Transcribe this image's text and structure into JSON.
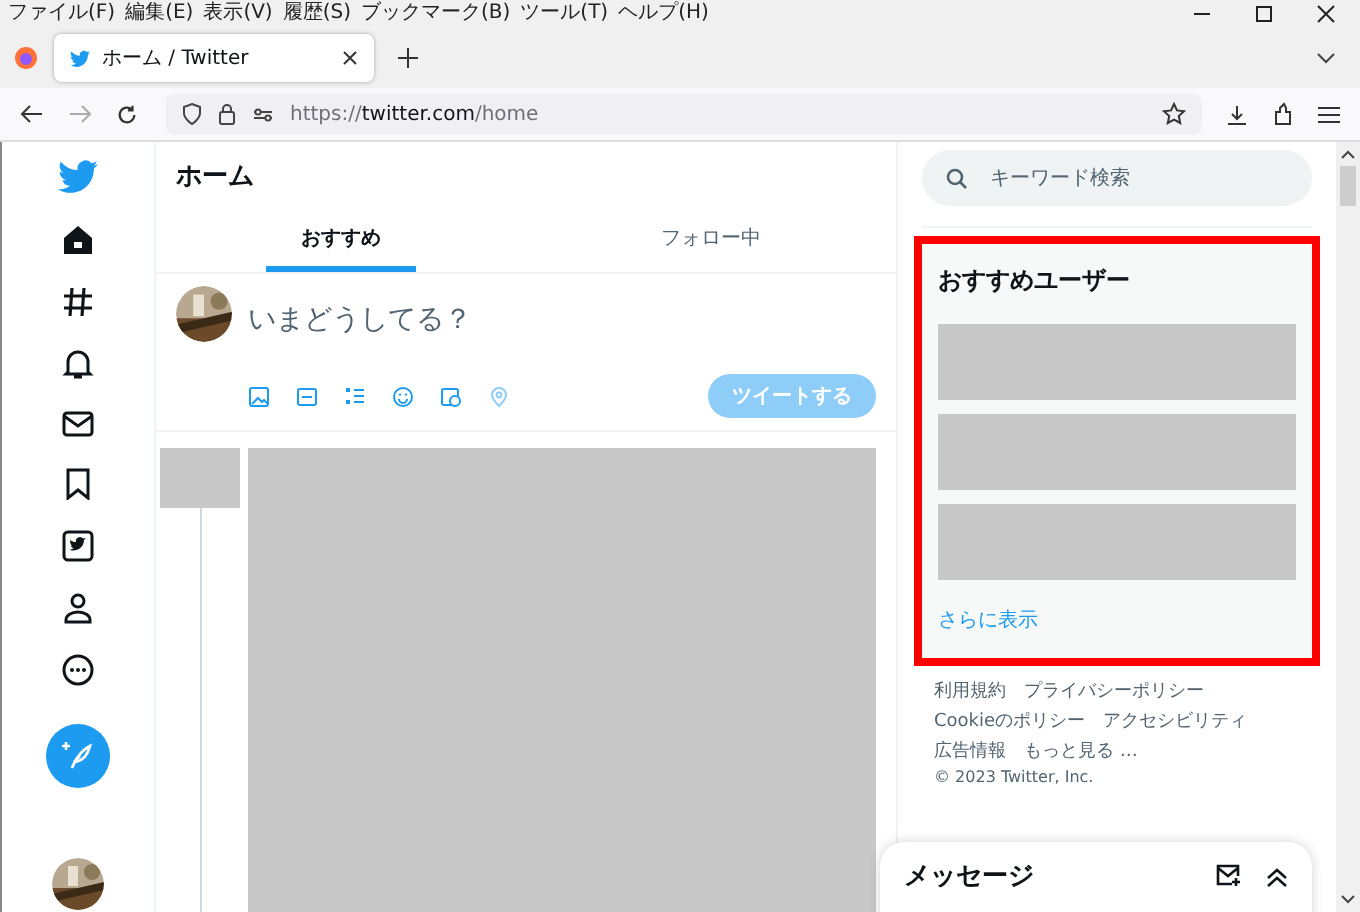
{
  "menu": [
    "ファイル(F)",
    "編集(E)",
    "表示(V)",
    "履歴(S)",
    "ブックマーク(B)",
    "ツール(T)",
    "ヘルプ(H)"
  ],
  "browser_tab": {
    "title": "ホーム / Twitter",
    "selected": true
  },
  "address": {
    "scheme": "https://",
    "domain": "twitter.com",
    "path": "/home"
  },
  "header": {
    "title": "ホーム"
  },
  "tabs": [
    {
      "label": "おすすめ",
      "selected": true
    },
    {
      "label": "フォロー中",
      "selected": false
    }
  ],
  "compose": {
    "placeholder": "いまどうしてる？",
    "button": "ツイートする",
    "disabled": true
  },
  "search": {
    "placeholder": "キーワード検索"
  },
  "recommend": {
    "title": "おすすめユーザー",
    "more": "さらに表示"
  },
  "footer": {
    "lines": [
      [
        "利用規約",
        "プライバシーポリシー"
      ],
      [
        "Cookieのポリシー",
        "アクセシビリティ"
      ],
      [
        "広告情報",
        "もっと見る …"
      ]
    ],
    "copyright": "© 2023 Twitter, Inc."
  },
  "messages": {
    "title": "メッセージ"
  }
}
